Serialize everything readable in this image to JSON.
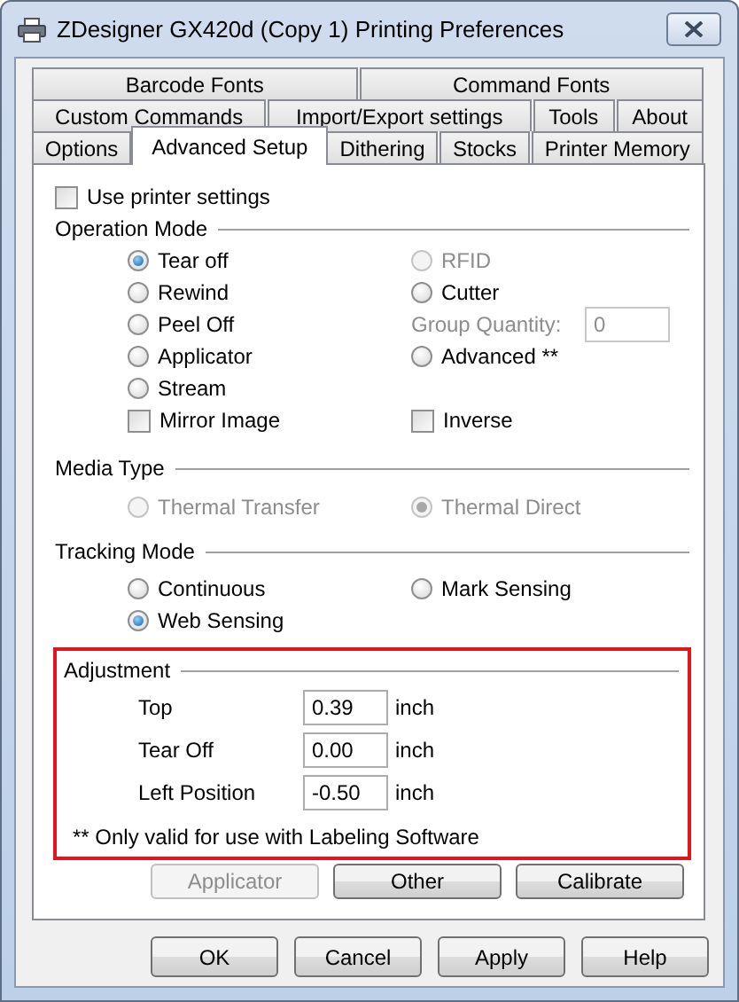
{
  "window": {
    "title": "ZDesigner GX420d (Copy 1) Printing Preferences"
  },
  "tab_rows": [
    [
      {
        "label": "Barcode Fonts",
        "selected": false
      },
      {
        "label": "Command Fonts",
        "selected": false
      }
    ],
    [
      {
        "label": "Custom Commands",
        "selected": false
      },
      {
        "label": "Import/Export settings",
        "selected": false
      },
      {
        "label": "Tools",
        "selected": false
      },
      {
        "label": "About",
        "selected": false
      }
    ],
    [
      {
        "label": "Options",
        "selected": false
      },
      {
        "label": "Advanced Setup",
        "selected": true
      },
      {
        "label": "Dithering",
        "selected": false
      },
      {
        "label": "Stocks",
        "selected": false
      },
      {
        "label": "Printer Memory",
        "selected": false
      }
    ]
  ],
  "use_printer_settings": {
    "label": "Use printer settings",
    "checked": false
  },
  "operation_mode": {
    "title": "Operation Mode",
    "rows": [
      {
        "left": {
          "kind": "radio",
          "label": "Tear off",
          "selected": true,
          "disabled": false
        },
        "right": {
          "kind": "radio",
          "label": "RFID",
          "selected": false,
          "disabled": true
        }
      },
      {
        "left": {
          "kind": "radio",
          "label": "Rewind",
          "selected": false,
          "disabled": false
        },
        "right": {
          "kind": "radio",
          "label": "Cutter",
          "selected": false,
          "disabled": false
        }
      },
      {
        "left": {
          "kind": "radio",
          "label": "Peel Off",
          "selected": false,
          "disabled": false
        },
        "right": {
          "kind": "field",
          "label": "Group Quantity:",
          "value": "0",
          "disabled": true
        }
      },
      {
        "left": {
          "kind": "radio",
          "label": "Applicator",
          "selected": false,
          "disabled": false
        },
        "right": {
          "kind": "radio",
          "label": "Advanced **",
          "selected": false,
          "disabled": false
        }
      },
      {
        "left": {
          "kind": "radio",
          "label": "Stream",
          "selected": false,
          "disabled": false
        }
      },
      {
        "left": {
          "kind": "checkbox",
          "label": "Mirror Image",
          "checked": false
        },
        "right": {
          "kind": "checkbox",
          "label": "Inverse",
          "checked": false
        }
      }
    ]
  },
  "media_type": {
    "title": "Media Type",
    "options": [
      {
        "label": "Thermal Transfer",
        "selected": false,
        "disabled": true
      },
      {
        "label": "Thermal Direct",
        "selected": true,
        "disabled": true
      }
    ]
  },
  "tracking_mode": {
    "title": "Tracking Mode",
    "options": [
      {
        "label": "Continuous",
        "selected": false,
        "disabled": false
      },
      {
        "label": "Mark Sensing",
        "selected": false,
        "disabled": false
      },
      {
        "label": "Web Sensing",
        "selected": true,
        "disabled": false
      }
    ]
  },
  "adjustment": {
    "title": "Adjustment",
    "highlighted": true,
    "rows": [
      {
        "label": "Top",
        "value": "0.39",
        "unit": "inch"
      },
      {
        "label": "Tear Off",
        "value": "0.00",
        "unit": "inch"
      },
      {
        "label": "Left Position",
        "value": "-0.50",
        "unit": "inch"
      }
    ],
    "note": "** Only valid for use with Labeling Software"
  },
  "panel_buttons": [
    {
      "label": "Applicator",
      "disabled": true
    },
    {
      "label": "Other",
      "disabled": false
    },
    {
      "label": "Calibrate",
      "disabled": false
    }
  ],
  "dialog_buttons": [
    {
      "label": "OK",
      "disabled": false
    },
    {
      "label": "Cancel",
      "disabled": false
    },
    {
      "label": "Apply",
      "disabled": false
    },
    {
      "label": "Help",
      "disabled": false
    }
  ]
}
